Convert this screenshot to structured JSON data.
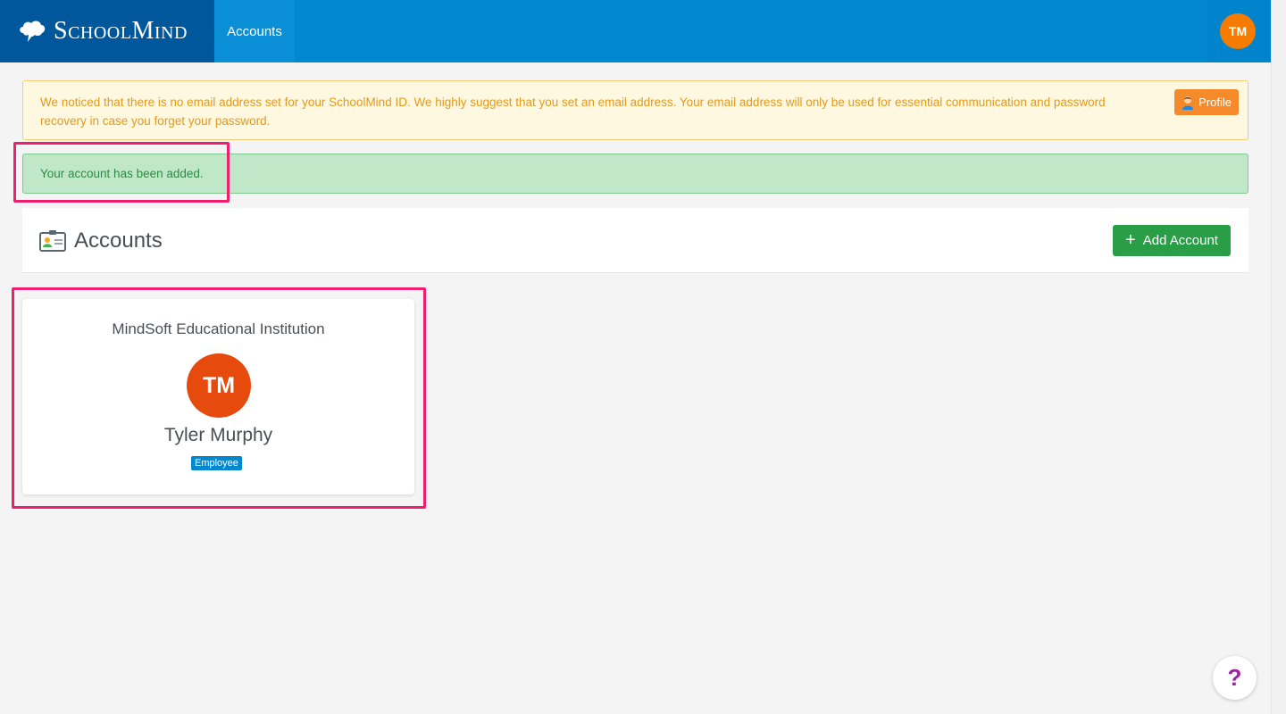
{
  "brand": {
    "name": "SchoolMind",
    "logo_icon": "cloud-brain-icon"
  },
  "nav": {
    "tab_label": "Accounts"
  },
  "user": {
    "initials": "TM",
    "avatar_color": "#f57c00"
  },
  "alerts": {
    "warning": {
      "text": "We noticed that there is no email address set for your SchoolMind ID. We highly suggest that you set an email address. Your email address will only be used for essential communication and password recovery in case you forget your password.",
      "button_label": "Profile",
      "button_icon": "person-icon"
    },
    "success": {
      "text": "Your account has been added."
    }
  },
  "accounts_panel": {
    "title": "Accounts",
    "icon": "id-card-icon",
    "add_button_label": "Add Account",
    "add_button_icon": "plus-icon"
  },
  "account_card": {
    "organization": "MindSoft Educational Institution",
    "initials": "TM",
    "name": "Tyler Murphy",
    "role": "Employee",
    "avatar_color": "#e64a0c"
  },
  "help": {
    "label": "?"
  },
  "colors": {
    "nav": "#0288d1",
    "brand_bg": "#01579b",
    "add_button": "#2a9d47",
    "highlight": "#ef1e6e"
  }
}
